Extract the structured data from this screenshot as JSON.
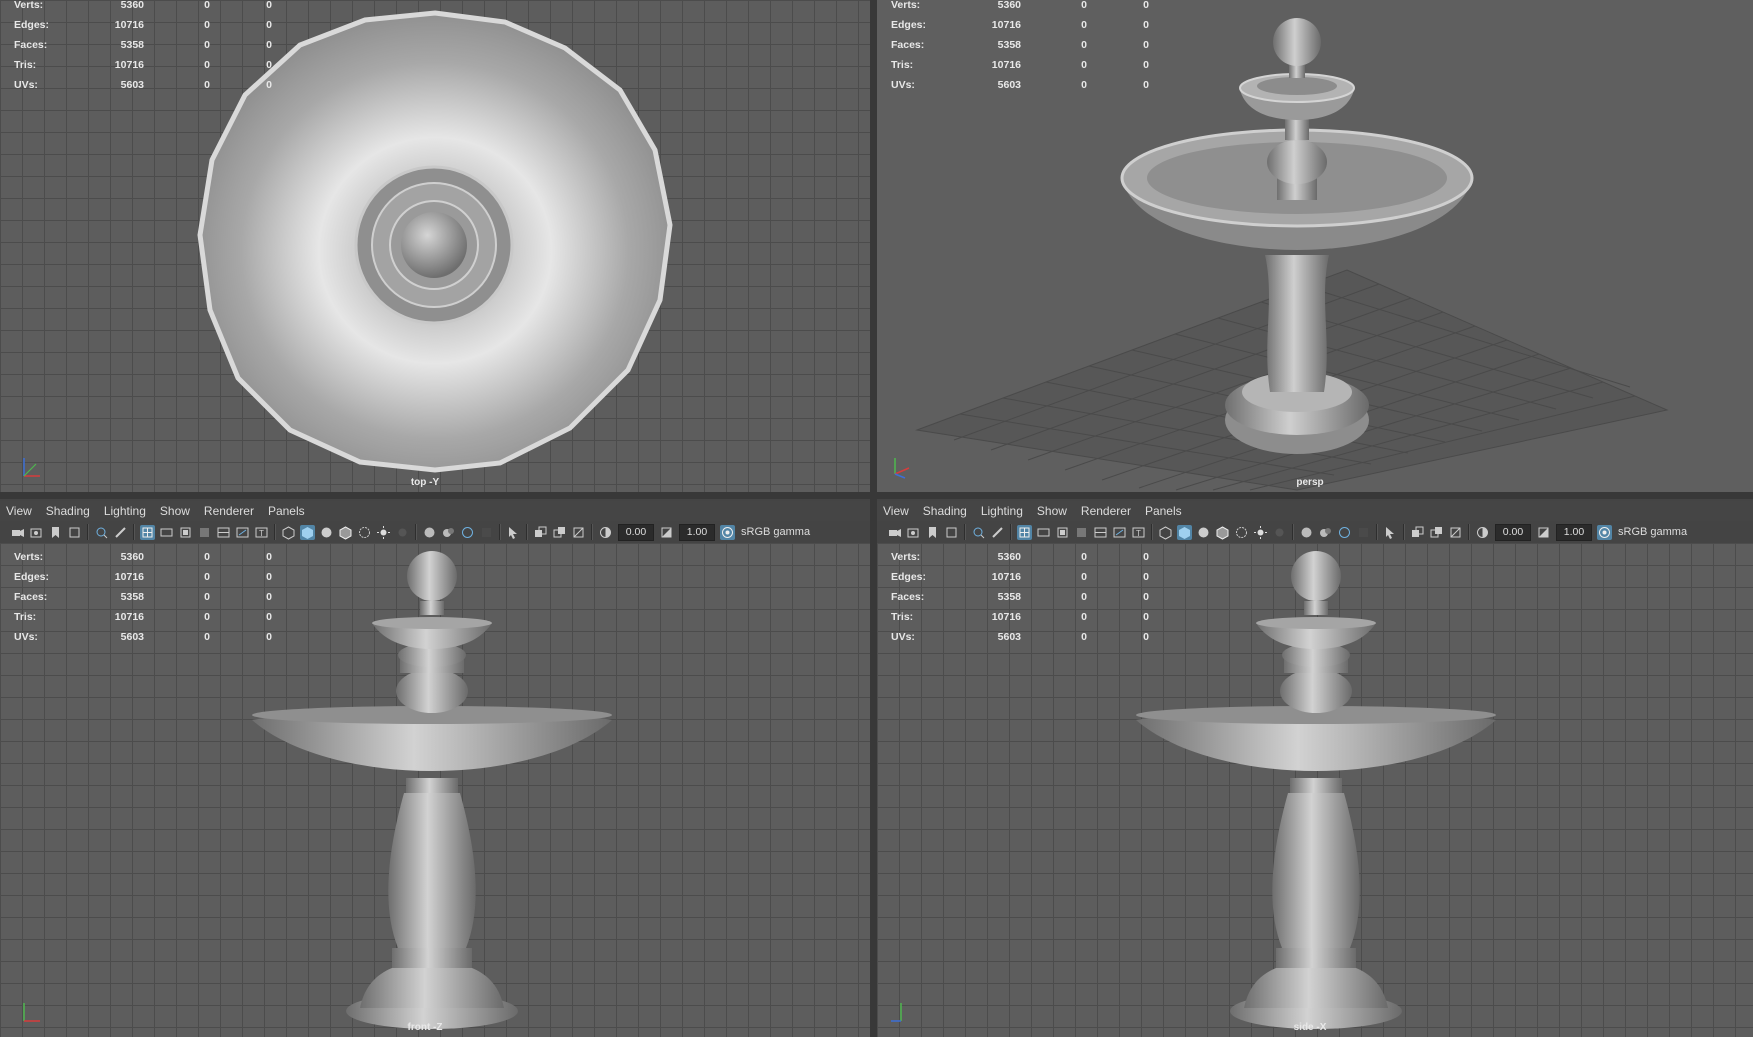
{
  "hud": {
    "rows": [
      {
        "label": "Verts:",
        "v1": "5360",
        "v2": "0",
        "v3": "0"
      },
      {
        "label": "Edges:",
        "v1": "10716",
        "v2": "0",
        "v3": "0"
      },
      {
        "label": "Faces:",
        "v1": "5358",
        "v2": "0",
        "v3": "0"
      },
      {
        "label": "Tris:",
        "v1": "10716",
        "v2": "0",
        "v3": "0"
      },
      {
        "label": "UVs:",
        "v1": "5603",
        "v2": "0",
        "v3": "0"
      }
    ]
  },
  "viewports": {
    "top": {
      "camera": "top -Y"
    },
    "persp": {
      "camera": "persp"
    },
    "front": {
      "camera": "front -Z"
    },
    "side": {
      "camera": "side -X"
    }
  },
  "panel_menu": [
    "View",
    "Shading",
    "Lighting",
    "Show",
    "Renderer",
    "Panels"
  ],
  "toolbar": {
    "exposure": "0.00",
    "gamma": "1.00",
    "color_space": "sRGB gamma"
  },
  "colors": {
    "viewport_bg": "#5d5d5d",
    "grid": "#4c4c4c",
    "active_button": "#5285a6",
    "model": "#b8b8b8"
  }
}
